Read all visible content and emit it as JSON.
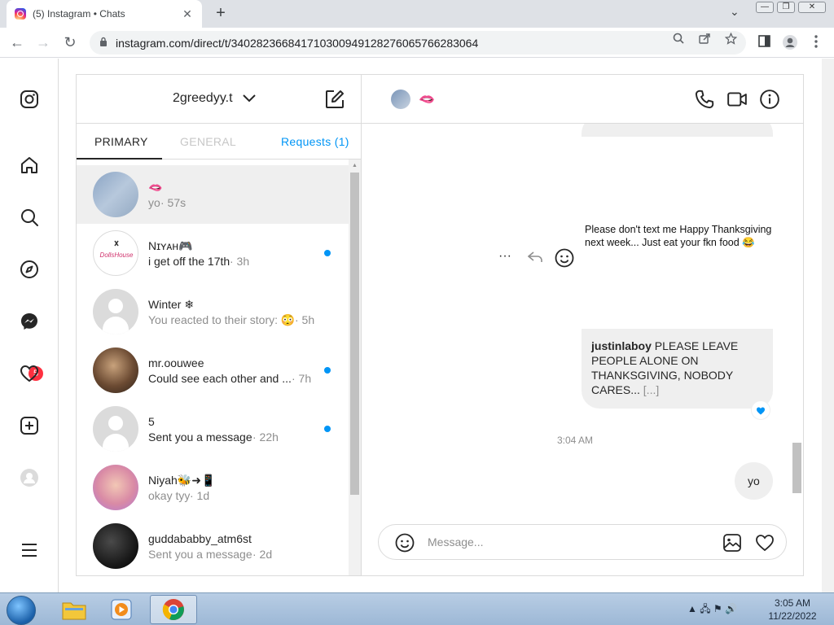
{
  "browser": {
    "tab_title": "(5) Instagram • Chats",
    "tab_close": "✕",
    "new_tab": "+",
    "tab_search": "⌄",
    "window_minimize": "—",
    "window_restore": "❐",
    "window_close": "✕",
    "back": "←",
    "forward": "→",
    "reload": "↻",
    "url": "instagram.com/direct/t/340282366841710300949128276065766283064"
  },
  "nav": {
    "messages_badge": "5"
  },
  "inbox": {
    "account": "2greedyy.t",
    "tabs": {
      "primary": "PRIMARY",
      "general": "GENERAL",
      "requests": "Requests (1)"
    },
    "threads": [
      {
        "name": "🫦",
        "preview": "yo",
        "time": " · 57s",
        "unread": false,
        "active": true
      },
      {
        "name": "Nɪʏᴀʜ🎮",
        "preview": "i get off the 17th",
        "time": " · 3h",
        "unread": true,
        "active": false
      },
      {
        "name": "Winter ❄",
        "preview": "You reacted to their story: 😳",
        "time": " · 5h",
        "unread": false,
        "active": false
      },
      {
        "name": "mr.oouwee",
        "preview": "Could see each other and ...",
        "time": " · 7h",
        "unread": true,
        "active": false
      },
      {
        "name": "5",
        "preview": "Sent you a message",
        "time": " · 22h",
        "unread": true,
        "active": false
      },
      {
        "name": "Niyah🐝➜📱",
        "preview": "okay tyy",
        "time": " · 1d",
        "unread": false,
        "active": false
      },
      {
        "name": "guddababby_atm6st",
        "preview": "Sent you a message",
        "time": " · 2d",
        "unread": false,
        "active": false
      }
    ]
  },
  "chat": {
    "contact_name": "🫦",
    "shared_post_text": "Please don't text me Happy Thanksgiving next week... Just eat your fkn food 😂",
    "caption_user": "justinlaboy",
    "caption_text": " PLEASE LEAVE PEOPLE ALONE ON THANKSGIVING, NOBODY CARES... ",
    "caption_more": "[...]",
    "more_actions": "···",
    "timestamp": "3:04 AM",
    "my_message": "yo",
    "composer_placeholder": "Message..."
  },
  "taskbar": {
    "time": "3:05 AM",
    "date": "11/22/2022",
    "tray_icons": "▲ 🖧 ⚑ 🔊"
  },
  "colors": {
    "accent": "#0095f6",
    "badge": "#ff3040",
    "border": "#dbdbdb",
    "bubble": "#efefef"
  }
}
